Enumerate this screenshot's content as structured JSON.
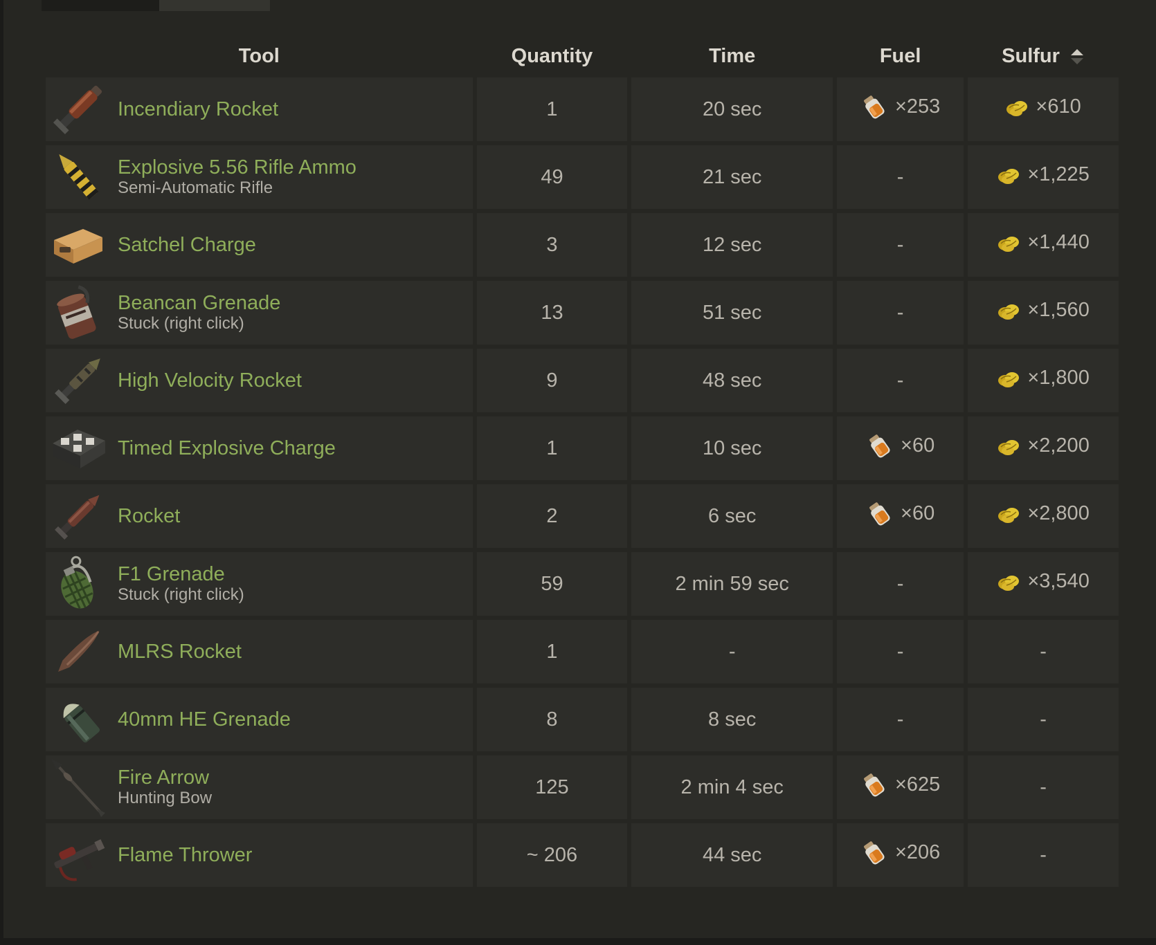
{
  "table": {
    "headers": {
      "tool": "Tool",
      "quantity": "Quantity",
      "time": "Time",
      "fuel": "Fuel",
      "sulfur": "Sulfur"
    },
    "sort": {
      "column": "Sulfur",
      "direction": "ascending",
      "icon": "sort-asc-icon"
    },
    "rows": [
      {
        "icon": "incendiary-rocket-icon",
        "name": "Incendiary Rocket",
        "sub": "",
        "quantity": "1",
        "time": "20 sec",
        "fuel": "×253",
        "sulfur": "×610"
      },
      {
        "icon": "explosive-ammo-icon",
        "name": "Explosive 5.56 Rifle Ammo",
        "sub": "Semi-Automatic Rifle",
        "quantity": "49",
        "time": "21 sec",
        "fuel": "-",
        "sulfur": "×1,225"
      },
      {
        "icon": "satchel-charge-icon",
        "name": "Satchel Charge",
        "sub": "",
        "quantity": "3",
        "time": "12 sec",
        "fuel": "-",
        "sulfur": "×1,440"
      },
      {
        "icon": "beancan-grenade-icon",
        "name": "Beancan Grenade",
        "sub": "Stuck (right click)",
        "quantity": "13",
        "time": "51 sec",
        "fuel": "-",
        "sulfur": "×1,560"
      },
      {
        "icon": "hv-rocket-icon",
        "name": "High Velocity Rocket",
        "sub": "",
        "quantity": "9",
        "time": "48 sec",
        "fuel": "-",
        "sulfur": "×1,800"
      },
      {
        "icon": "c4-icon",
        "name": "Timed Explosive Charge",
        "sub": "",
        "quantity": "1",
        "time": "10 sec",
        "fuel": "×60",
        "sulfur": "×2,200"
      },
      {
        "icon": "rocket-icon",
        "name": "Rocket",
        "sub": "",
        "quantity": "2",
        "time": "6 sec",
        "fuel": "×60",
        "sulfur": "×2,800"
      },
      {
        "icon": "f1-grenade-icon",
        "name": "F1 Grenade",
        "sub": "Stuck (right click)",
        "quantity": "59",
        "time": "2 min 59 sec",
        "fuel": "-",
        "sulfur": "×3,540"
      },
      {
        "icon": "mlrs-rocket-icon",
        "name": "MLRS Rocket",
        "sub": "",
        "quantity": "1",
        "time": "-",
        "fuel": "-",
        "sulfur": "-"
      },
      {
        "icon": "40mm-grenade-icon",
        "name": "40mm HE Grenade",
        "sub": "",
        "quantity": "8",
        "time": "8 sec",
        "fuel": "-",
        "sulfur": "-"
      },
      {
        "icon": "fire-arrow-icon",
        "name": "Fire Arrow",
        "sub": "Hunting Bow",
        "quantity": "125",
        "time": "2 min 4 sec",
        "fuel": "×625",
        "sulfur": "-"
      },
      {
        "icon": "flamethrower-icon",
        "name": "Flame Thrower",
        "sub": "",
        "quantity": "~ 206",
        "time": "44 sec",
        "fuel": "×206",
        "sulfur": "-"
      }
    ],
    "resource_icons": {
      "fuel": "low-grade-fuel-icon",
      "sulfur": "sulfur-icon"
    }
  },
  "colors": {
    "tool_name": "#8fae5a",
    "cell_bg": "#2d2d29",
    "page_bg": "#262622",
    "header_text": "#dcd8cf"
  }
}
